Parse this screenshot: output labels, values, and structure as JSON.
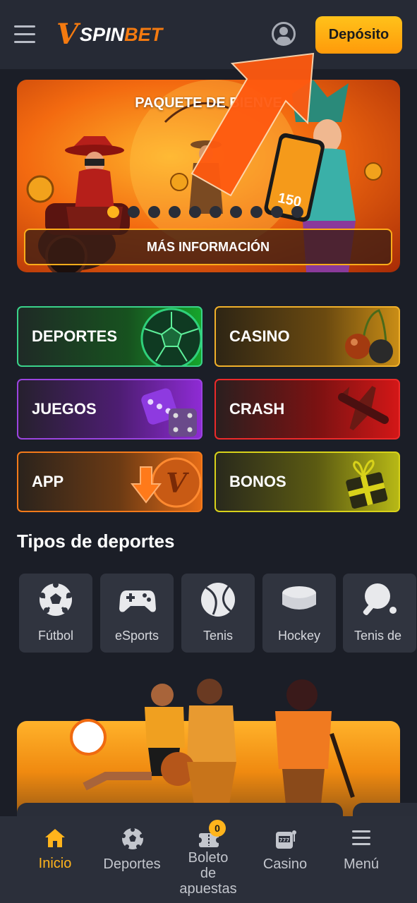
{
  "header": {
    "logo_mark": "V",
    "logo_word_white": "SPIN",
    "logo_word_orange": "BET",
    "deposit_label": "Depósito"
  },
  "banner": {
    "title": "PAQUETE DE BIENVE",
    "more_info_label": "MÁS INFORMACIÓN",
    "phone_amount": "150",
    "slide_count": 10,
    "active_slide": 1
  },
  "categories": [
    {
      "label": "DEPORTES",
      "icon": "soccer-ball-icon",
      "color": "#3ad28a"
    },
    {
      "label": "CASINO",
      "icon": "cherries-icon",
      "color": "#f0b02a"
    },
    {
      "label": "JUEGOS",
      "icon": "dice-icon",
      "color": "#9b44e0"
    },
    {
      "label": "CRASH",
      "icon": "airplane-icon",
      "color": "#ec2a2a"
    },
    {
      "label": "APP",
      "icon": "download-icon",
      "color": "#f47a1a"
    },
    {
      "label": "BONOS",
      "icon": "gift-icon",
      "color": "#d8d21a"
    }
  ],
  "sports_section": {
    "title": "Tipos de deportes",
    "items": [
      {
        "label": "Fútbol",
        "icon": "soccer-ball-icon"
      },
      {
        "label": "eSports",
        "icon": "gamepad-icon"
      },
      {
        "label": "Tenis",
        "icon": "tennis-ball-icon"
      },
      {
        "label": "Hockey",
        "icon": "hockey-puck-icon"
      },
      {
        "label": "Tenis de",
        "icon": "table-tennis-icon"
      }
    ]
  },
  "bottom_nav": {
    "active": "Inicio",
    "items": [
      {
        "label": "Inicio",
        "icon": "home-icon"
      },
      {
        "label": "Deportes",
        "icon": "soccer-ball-icon"
      },
      {
        "label_line1": "Boleto",
        "label_line2": "de",
        "label_line3": "apuestas",
        "badge": "0",
        "icon": "ticket-icon"
      },
      {
        "label": "Casino",
        "icon": "slot-machine-icon"
      },
      {
        "label": "Menú",
        "icon": "menu-icon"
      }
    ]
  },
  "colors": {
    "accent": "#ffb41c",
    "background": "#1b1e27",
    "header": "#262a35",
    "arrow": "#ff5a10"
  }
}
